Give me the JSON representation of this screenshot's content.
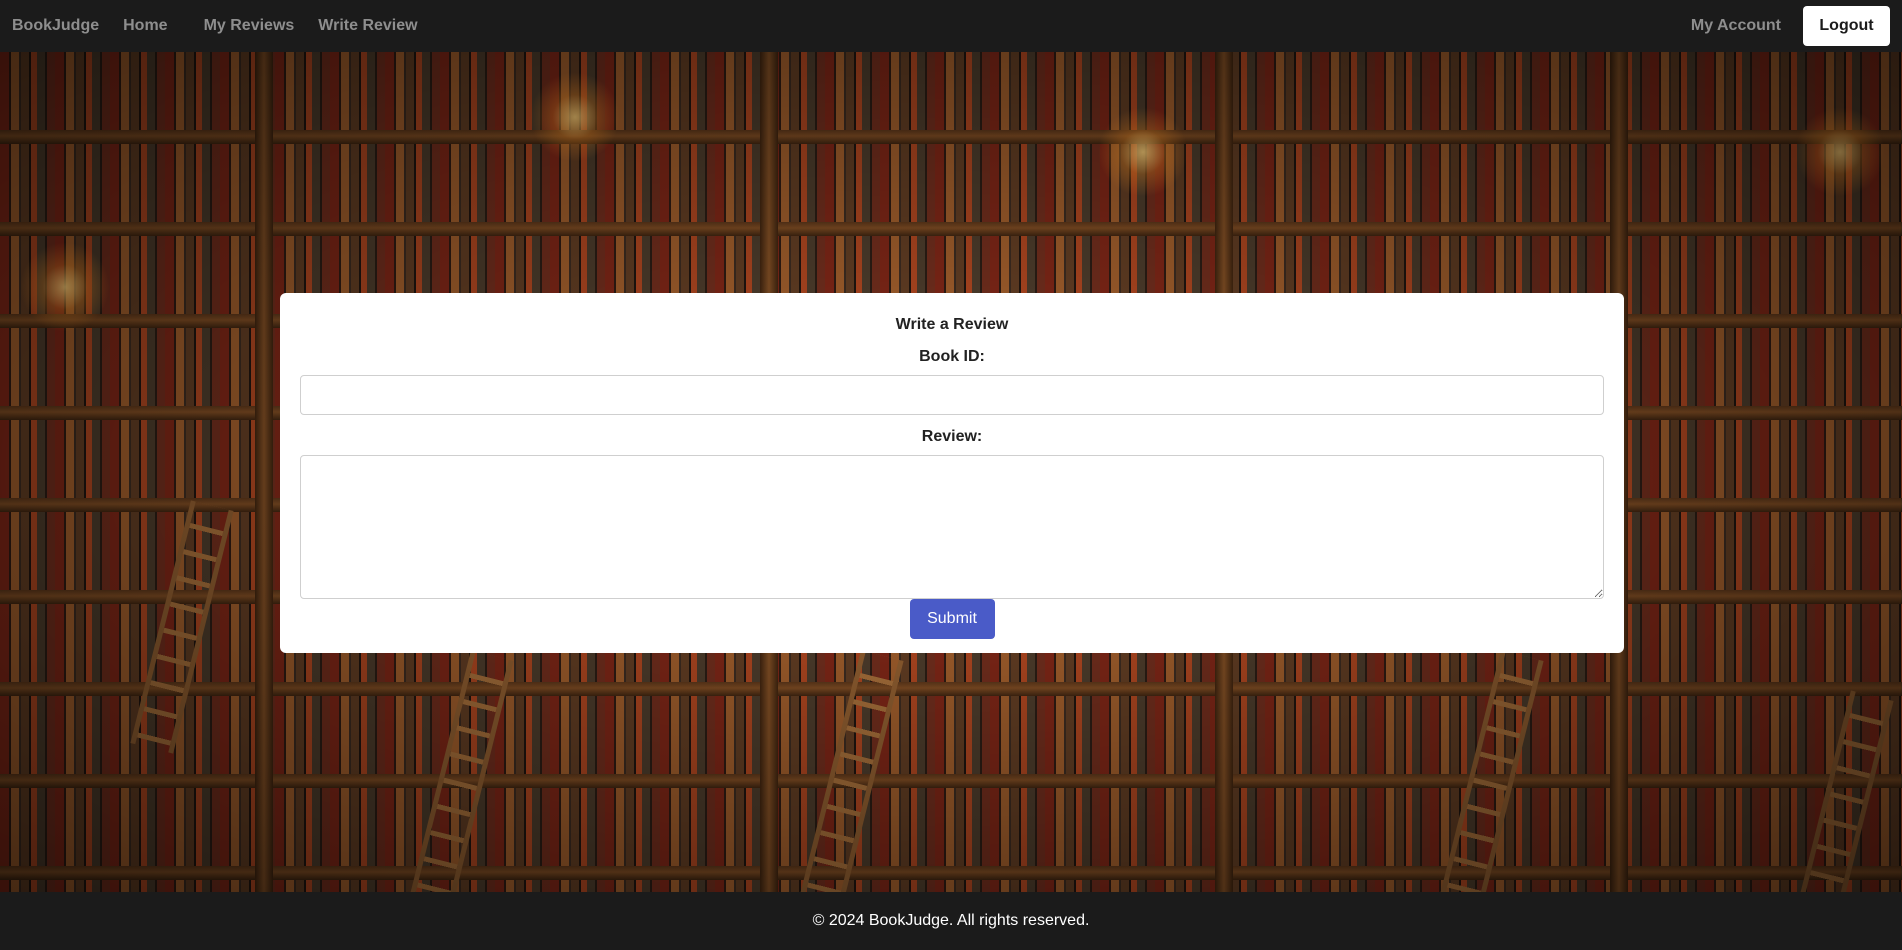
{
  "nav": {
    "brand": "BookJudge",
    "links": [
      "Home",
      "My Reviews",
      "Write Review"
    ],
    "account": "My Account",
    "logout": "Logout"
  },
  "form": {
    "title": "Write a Review",
    "book_id_label": "Book ID:",
    "book_id_value": "",
    "review_label": "Review:",
    "review_value": "",
    "submit_label": "Submit"
  },
  "footer": {
    "text": "© 2024 BookJudge. All rights reserved."
  },
  "colors": {
    "nav_bg": "#1b1b1b",
    "nav_link": "#8e8e8e",
    "submit_bg": "#4a5bc8",
    "card_bg": "#ffffff"
  }
}
